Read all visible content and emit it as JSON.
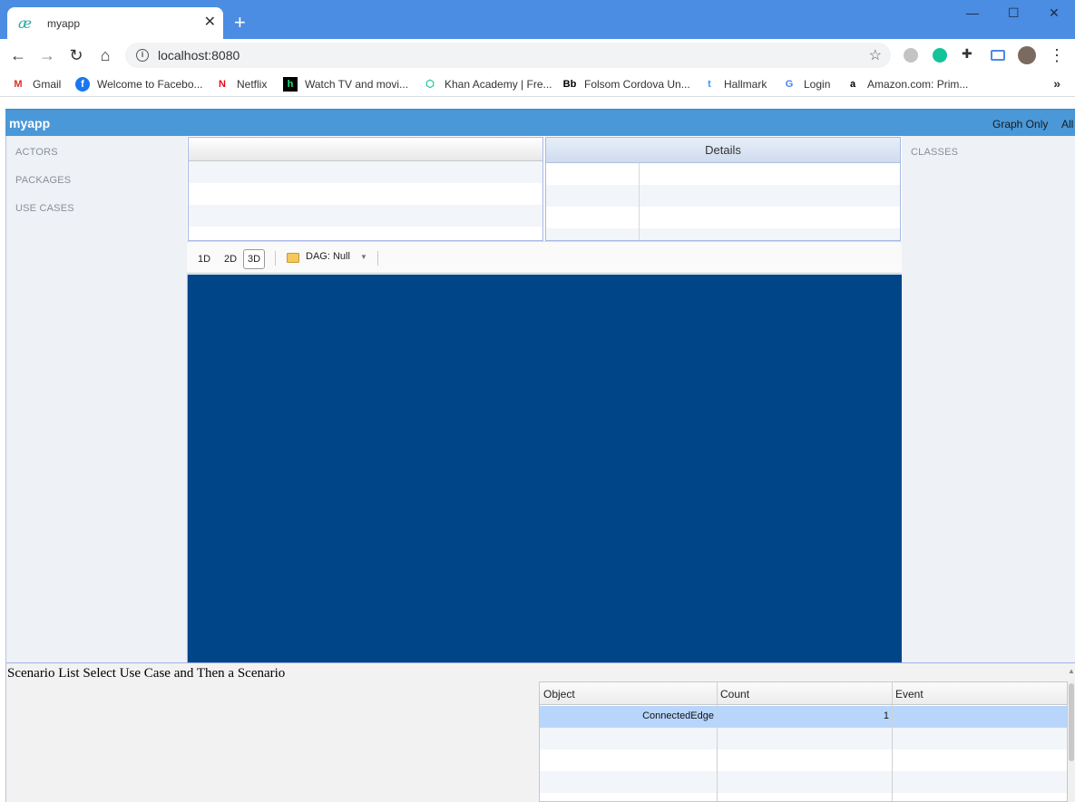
{
  "browser": {
    "tab_title": "myapp",
    "tab_favicon": "æ",
    "new_tab_icon": "plus-icon",
    "url": "localhost:8080",
    "bookmarks": [
      {
        "label": "Gmail",
        "icon": "gmail-icon",
        "color": "#d93025"
      },
      {
        "label": "Welcome to Facebo...",
        "icon": "facebook-icon",
        "color": "#1877f2"
      },
      {
        "label": "Netflix",
        "icon": "netflix-icon",
        "color": "#e50914"
      },
      {
        "label": "Watch TV and movi...",
        "icon": "hulu-icon",
        "color": "#1ce783"
      },
      {
        "label": "Khan Academy | Fre...",
        "icon": "khan-academy-icon",
        "color": "#14bf96"
      },
      {
        "label": "Folsom Cordova Un...",
        "icon": "blackboard-icon",
        "color": "#000000"
      },
      {
        "label": "Hallmark",
        "icon": "hallmark-icon",
        "color": "#3399ff"
      },
      {
        "label": "Login",
        "icon": "google-icon",
        "color": "#4285f4"
      },
      {
        "label": "Amazon.com: Prim...",
        "icon": "amazon-icon",
        "color": "#000000"
      }
    ],
    "bookmarks_more": "»"
  },
  "app": {
    "title": "myapp",
    "header_links": [
      "Graph Only",
      "All"
    ],
    "left_nav": [
      "ACTORS",
      "PACKAGES",
      "USE CASES"
    ],
    "right_nav": [
      "CLASSES"
    ],
    "details_header": "Details",
    "view_toolbar": {
      "buttons": [
        "1D",
        "2D",
        "3D"
      ],
      "active": "3D",
      "dag_label": "DAG: Null"
    },
    "canvas_color": "#004587",
    "scenario_text": "Scenario List Select Use Case and Then a Scenario",
    "stats_table": {
      "columns": [
        "Object",
        "Count",
        "Event"
      ],
      "rows": [
        {
          "object": "ConnectedEdge",
          "count": "1",
          "event": ""
        }
      ]
    }
  }
}
